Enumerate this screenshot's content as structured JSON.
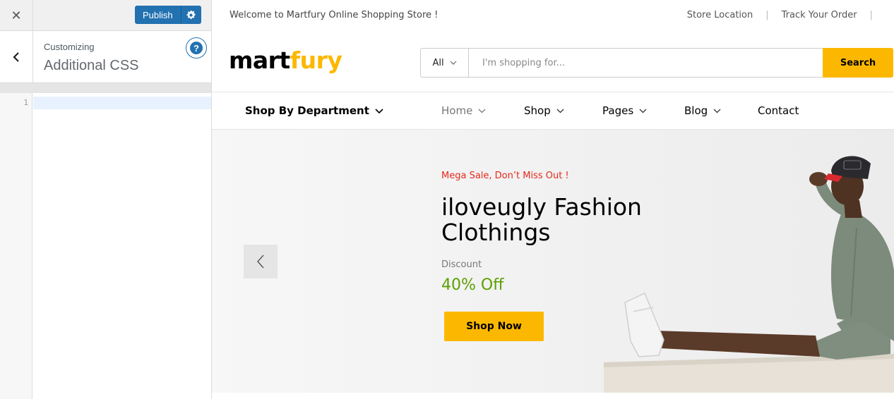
{
  "customizer": {
    "publish_label": "Publish",
    "customizing_label": "Customizing",
    "section_title": "Additional CSS",
    "help_glyph": "?",
    "line_number": "1",
    "icons": [
      "close-icon",
      "gear-icon",
      "back-arrow-icon",
      "help-icon"
    ],
    "accent_color": "#2271b1"
  },
  "site": {
    "welcome": "Welcome to Martfury Online Shopping Store !",
    "top_links": [
      "Store Location",
      "Track Your Order"
    ],
    "logo_part1": "mart",
    "logo_part2": "fury",
    "search": {
      "category": "All",
      "placeholder": "I'm shopping for...",
      "button": "Search"
    },
    "nav": {
      "department": "Shop By Department",
      "items": [
        "Home",
        "Shop",
        "Pages",
        "Blog",
        "Contact"
      ]
    },
    "hero": {
      "tag": "Mega Sale, Don’t Miss Out !",
      "title": "iloveugly Fashion Clothings",
      "discount_label": "Discount",
      "discount_value": "40% Off",
      "button": "Shop Now"
    },
    "colors": {
      "brand_yellow": "#fcb800",
      "sale_red": "#e4291c",
      "discount_green": "#5ba000"
    }
  }
}
